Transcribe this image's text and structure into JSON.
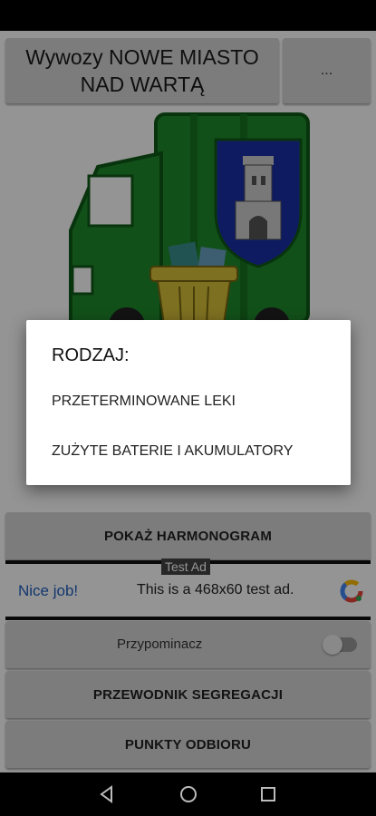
{
  "header": {
    "title": "Wywozy NOWE MIASTO NAD WARTĄ",
    "menu_label": "..."
  },
  "image": {
    "icon": "garbage-truck-with-coat-of-arms"
  },
  "buttons": {
    "harmonogram": "POKAŻ HARMONOGRAM",
    "segregation_guide": "PRZEWODNIK SEGREGACJI",
    "pickup_points": "PUNKTY ODBIORU"
  },
  "ad": {
    "tag": "Test Ad",
    "nice": "Nice job!",
    "text": "This is a 468x60 test ad."
  },
  "reminder": {
    "label": "Przypominacz",
    "enabled": false
  },
  "dialog": {
    "title": "RODZAJ:",
    "items": [
      "PRZETERMINOWANE LEKI",
      "ZUŻYTE BATERIE I AKUMULATORY"
    ]
  },
  "nav": {
    "back_icon": "back-triangle-icon",
    "home_icon": "home-circle-icon",
    "recents_icon": "recents-square-icon"
  },
  "colors": {
    "truck_green": "#1f8a2c",
    "truck_dark": "#0e5a18",
    "crest_blue": "#1a2fa8",
    "bin_yellow": "#d9c23a",
    "link_blue": "#1f5fbf"
  }
}
